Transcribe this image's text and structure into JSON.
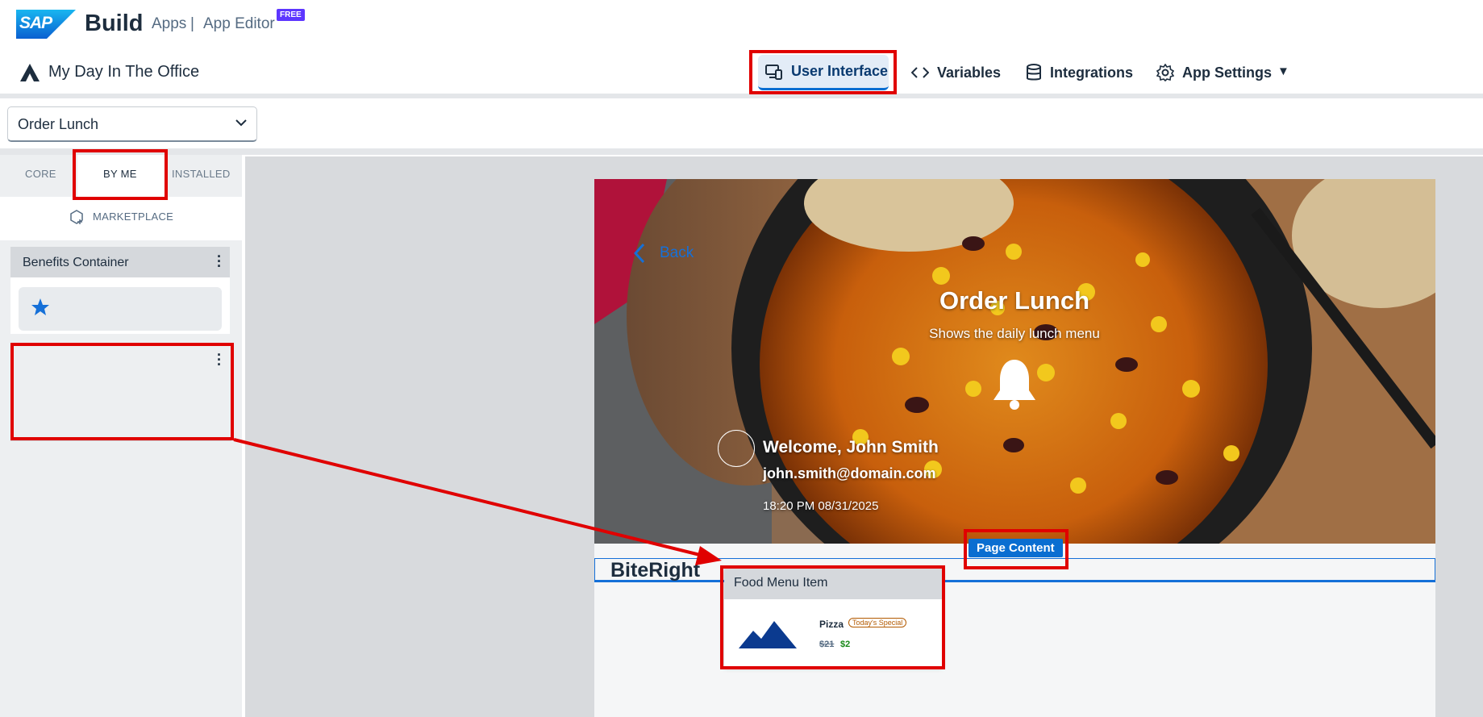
{
  "header": {
    "logo_text": "SAP",
    "product": "Build",
    "breadcrumb": [
      "Apps",
      "|",
      "App Editor"
    ],
    "badge": "FREE",
    "project_title": "My Day In The Office",
    "nav": [
      {
        "label": "User Interface",
        "icon": "device-icon",
        "active": true
      },
      {
        "label": "Variables",
        "icon": "code-icon"
      },
      {
        "label": "Integrations",
        "icon": "database-icon"
      },
      {
        "label": "App Settings",
        "icon": "gear-icon"
      }
    ]
  },
  "page_selector": {
    "value": "Order Lunch"
  },
  "component_panel": {
    "tabs": [
      "CORE",
      "BY ME",
      "INSTALLED"
    ],
    "active_tab": "BY ME",
    "marketplace_label": "MARKETPLACE",
    "components": [
      {
        "title": "Benefits Container",
        "icon": "star-icon"
      },
      {
        "title": "",
        "empty": true
      }
    ]
  },
  "canvas": {
    "hero": {
      "back_label": "Back",
      "title": "Order Lunch",
      "subtitle": "Shows the daily lunch menu",
      "welcome": "Welcome, John Smith",
      "email": "john.smith@domain.com",
      "datetime": "18:20 PM 08/31/2025"
    },
    "selected_badge": "Page Content",
    "brand_title": "BiteRight"
  },
  "drag_preview": {
    "title": "Food Menu Item",
    "item_name": "Pizza",
    "badge": "Today's Special",
    "old_price": "$21",
    "new_price": "$2"
  },
  "colors": {
    "accent": "#0a6ed1",
    "annotation_red": "#e00000",
    "free_badge": "#5d36ff",
    "price_green": "#188918"
  }
}
